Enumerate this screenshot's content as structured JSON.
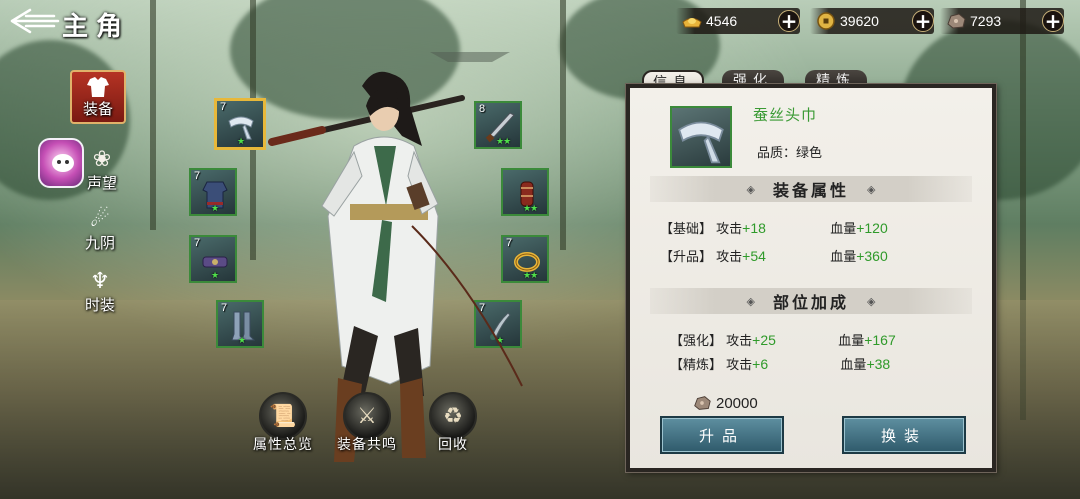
{
  "header": {
    "title": "主角"
  },
  "currencies": [
    {
      "icon": "gold-ingot-icon",
      "value": "4546"
    },
    {
      "icon": "coin-icon",
      "value": "39620"
    },
    {
      "icon": "ore-icon",
      "value": "7293"
    }
  ],
  "side_menu": [
    {
      "label": "装备",
      "icon": "armor-icon",
      "active": true
    },
    {
      "label": "声望",
      "icon": "lotus-icon"
    },
    {
      "label": "九阴",
      "icon": "flame-icon"
    },
    {
      "label": "时装",
      "icon": "fashion-icon"
    }
  ],
  "slots": {
    "left": [
      {
        "level": "7",
        "stars": "★",
        "item": "silk-headband"
      },
      {
        "level": "7",
        "stars": "★",
        "item": "robe"
      },
      {
        "level": "7",
        "stars": "★",
        "item": "belt"
      },
      {
        "level": "7",
        "stars": "★",
        "item": "boots"
      }
    ],
    "right": [
      {
        "level": "8",
        "stars": "★★",
        "item": "blade"
      },
      {
        "level": "",
        "stars": "★★",
        "item": "scroll-bracer"
      },
      {
        "level": "7",
        "stars": "★★",
        "item": "gold-ring"
      },
      {
        "level": "7",
        "stars": "★",
        "item": "dagger"
      }
    ]
  },
  "bottom_buttons": [
    {
      "label": "属性总览",
      "icon": "scroll-icon"
    },
    {
      "label": "装备共鸣",
      "icon": "resonance-icon"
    },
    {
      "label": "回收",
      "icon": "recycle-icon"
    }
  ],
  "panel": {
    "tabs": [
      {
        "label": "信息",
        "active": true
      },
      {
        "label": "强化"
      },
      {
        "label": "精炼"
      }
    ],
    "item_name": "蚕丝头巾",
    "item_quality": "品质：绿色",
    "section1": "装备属性",
    "base": {
      "tag": "【基础】",
      "atk_label": "攻击",
      "atk_val": "+18",
      "hp_label": "血量",
      "hp_val": "+120"
    },
    "upgrade": {
      "tag": "【升品】",
      "atk_label": "攻击",
      "atk_val": "+54",
      "hp_label": "血量",
      "hp_val": "+360"
    },
    "section2": "部位加成",
    "enhance": {
      "tag": "【强化】",
      "atk_label": "攻击",
      "atk_val": "+25",
      "hp_label": "血量",
      "hp_val": "+167"
    },
    "refine": {
      "tag": "【精炼】",
      "atk_label": "攻击",
      "atk_val": "+6",
      "hp_label": "血量",
      "hp_val": "+38"
    },
    "cost": "20000",
    "btn_upgrade": "升品",
    "btn_swap": "换装"
  },
  "colors": {
    "stat_green": "#2f9a2a",
    "name_green": "#3a9a34",
    "selected_gold": "#e8b83a",
    "slot_green": "#3b8a3a"
  }
}
